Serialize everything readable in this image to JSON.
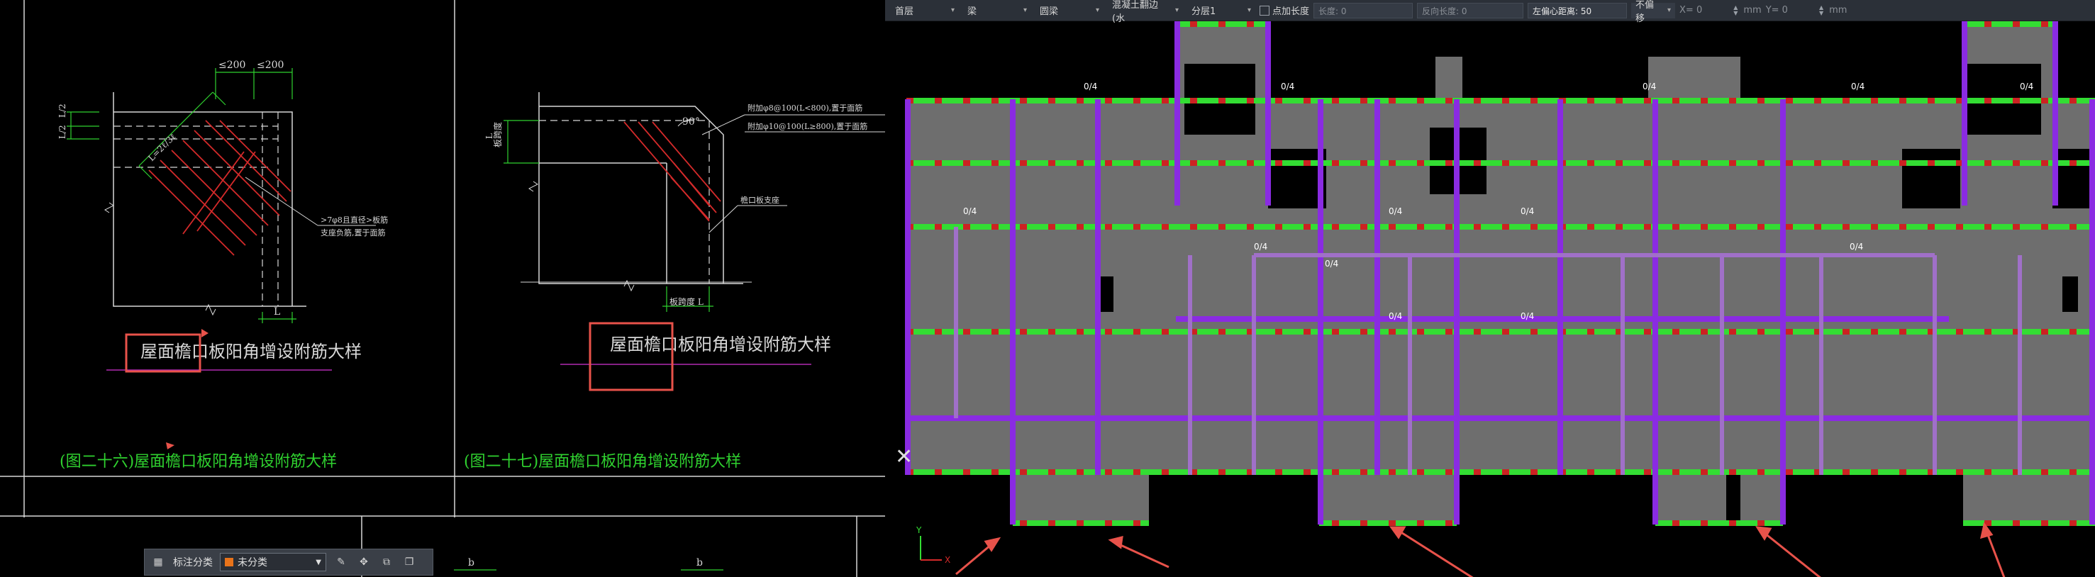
{
  "left_drawing": {
    "detail_left": {
      "title": "屋面檐口板阳角增设附筋大样",
      "caption": "(图二十六)屋面檐口板阳角增设附筋大样",
      "dim_top_1": "≤200",
      "dim_top_2": "≤200",
      "dim_left_1": "L/2",
      "dim_left_2": "L/2",
      "diag_dim": "L=2ℓ/3ℓ",
      "note_line_1": ">7φ8且直径>板筋",
      "note_line_2": "支座负筋,置于面筋",
      "dim_bottom": "L"
    },
    "detail_right": {
      "title": "屋面檐口板阳角增设附筋大样",
      "caption": "(图二十七)屋面檐口板阳角增设附筋大样",
      "angle": "90°",
      "note_1": "附加φ8@100(L<800),置于面筋",
      "note_2": "附加φ10@100(L≥800),置于面筋",
      "note_3": "檐口板支座",
      "dim_left": "L",
      "dim_left_label": "板跨度",
      "dim_bottom": "板跨度 L"
    },
    "bottom_labels": [
      "b",
      "b"
    ]
  },
  "annotation_panel": {
    "label": "标注分类",
    "category_value": "未分类",
    "icons": [
      "grid-icon",
      "edit-icon",
      "move-icon",
      "copy-icon",
      "paste-icon"
    ]
  },
  "model_toolbar": {
    "floor": "首层",
    "component": "梁",
    "type": "圆梁",
    "material": "混凝土翻边 (水",
    "layer": "分层1",
    "checkbox_label": "点加长度",
    "length_label": "长度: 0",
    "reverse_length_label": "反向长度: 0",
    "offset_label": "左偏心距离: 50",
    "no_offset": "不偏移",
    "x_label": "X= 0",
    "y_label": "Y= 0",
    "unit_1": "mm",
    "unit_2": "mm"
  },
  "model_view": {
    "beam_label": "0/4",
    "axis_x": "X",
    "axis_y": "Y",
    "colors": {
      "slab": "#6e6e6e",
      "beam_green": "#33dd33",
      "beam_purple": "#8a2be2",
      "beam_lilac": "#a070c8",
      "column_red": "#cc2222",
      "arrow": "#e8524a"
    }
  }
}
